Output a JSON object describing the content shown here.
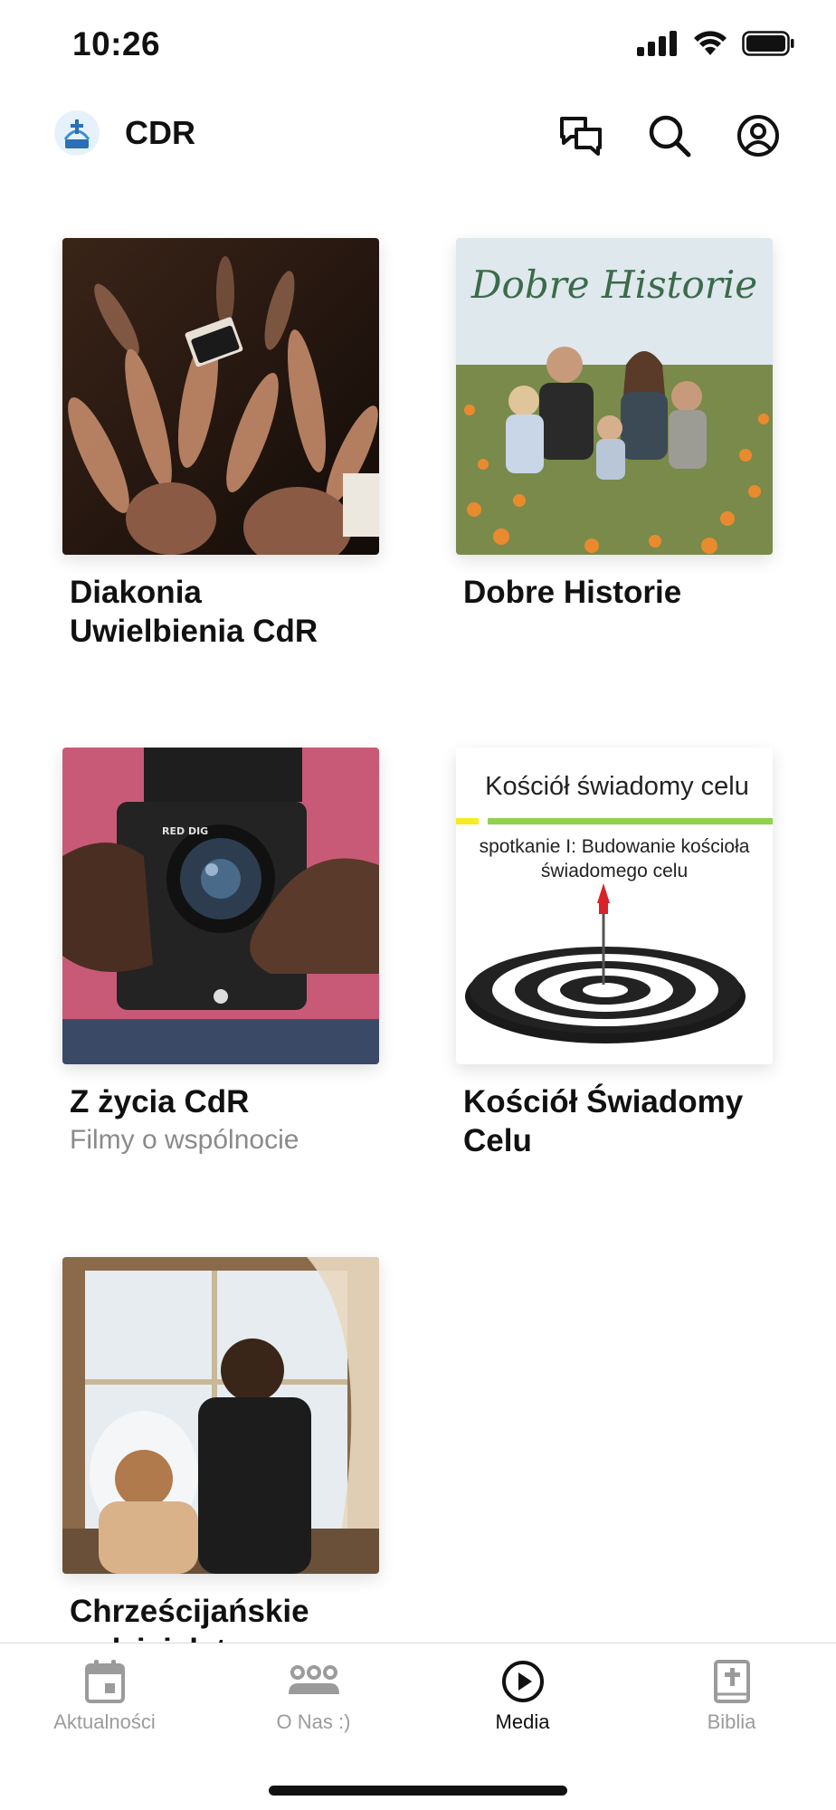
{
  "status_bar": {
    "time": "10:26"
  },
  "header": {
    "app_title": "CDR"
  },
  "media": {
    "items": [
      {
        "title": "Diakonia Uwielbienia CdR",
        "subtitle": ""
      },
      {
        "title": "Dobre Historie",
        "subtitle": "",
        "image_text": "Dobre Historie"
      },
      {
        "title": "Z życia CdR",
        "subtitle": "Filmy o wspólnocie"
      },
      {
        "title": "Kościół Świadomy Celu",
        "subtitle": "",
        "image_text": "Kościół świadomy celu",
        "image_subtext": "spotkanie I: Budowanie kościoła świadomego celu"
      },
      {
        "title": "Chrześcijańskie rodzicielstwo",
        "subtitle": ""
      }
    ]
  },
  "tabs": [
    {
      "label": "Aktualności",
      "icon": "calendar-icon",
      "active": false
    },
    {
      "label": "O Nas :)",
      "icon": "people-icon",
      "active": false
    },
    {
      "label": "Media",
      "icon": "play-icon",
      "active": true
    },
    {
      "label": "Biblia",
      "icon": "bible-icon",
      "active": false
    }
  ],
  "colors": {
    "accent": "#111111",
    "inactive": "#9b9b9b",
    "background": "#ffffff",
    "dart_red": "#d8232a",
    "green_line": "#8fd14f",
    "script_green": "#3b6b4b"
  }
}
